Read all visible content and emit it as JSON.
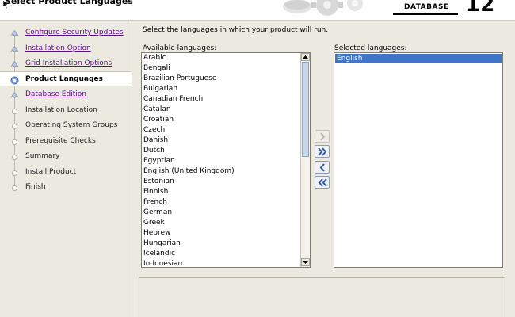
{
  "header": {
    "title": "Select Product Languages",
    "logo_text": "DATABASE",
    "version": "12"
  },
  "steps": [
    {
      "label": "Configure Security Updates",
      "state": "done"
    },
    {
      "label": "Installation Option",
      "state": "done"
    },
    {
      "label": "Grid Installation Options",
      "state": "done"
    },
    {
      "label": "Product Languages",
      "state": "current"
    },
    {
      "label": "Database Edition",
      "state": "link"
    },
    {
      "label": "Installation Location",
      "state": "pending"
    },
    {
      "label": "Operating System Groups",
      "state": "pending"
    },
    {
      "label": "Prerequisite Checks",
      "state": "pending"
    },
    {
      "label": "Summary",
      "state": "pending"
    },
    {
      "label": "Install Product",
      "state": "pending"
    },
    {
      "label": "Finish",
      "state": "pending"
    }
  ],
  "main": {
    "instruction": "Select the languages in which your product will run.",
    "available_label": "Available languages:",
    "selected_label": "Selected languages:",
    "available": [
      "Arabic",
      "Bengali",
      "Brazilian Portuguese",
      "Bulgarian",
      "Canadian French",
      "Catalan",
      "Croatian",
      "Czech",
      "Danish",
      "Dutch",
      "Egyptian",
      "English (United Kingdom)",
      "Estonian",
      "Finnish",
      "French",
      "German",
      "Greek",
      "Hebrew",
      "Hungarian",
      "Icelandic",
      "Indonesian"
    ],
    "selected": [
      "English"
    ]
  },
  "colors": {
    "selection": "#3f74c7",
    "visited_link": "#5a0d8a"
  },
  "icons": {
    "move_right": "single-right-arrow-icon",
    "move_all_right": "double-right-arrow-icon",
    "move_left": "single-left-arrow-icon",
    "move_all_left": "double-left-arrow-icon"
  }
}
